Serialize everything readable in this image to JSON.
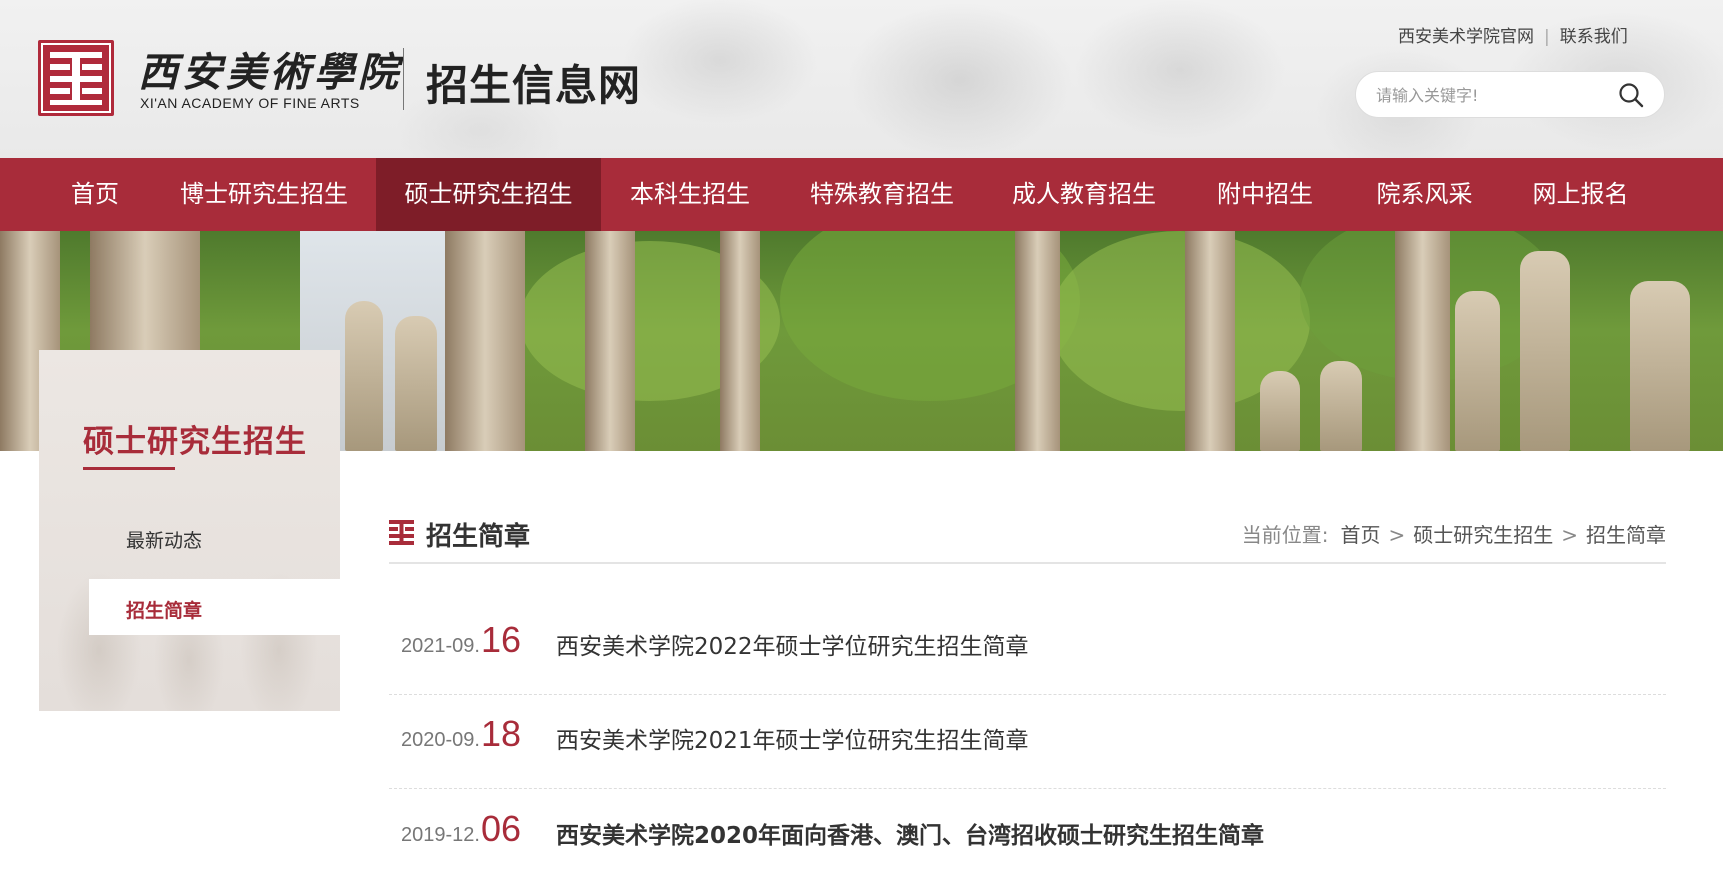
{
  "header": {
    "logo_cn": "西安美術學院",
    "logo_en": "XI'AN ACADEMY OF FINE ARTS",
    "site_title": "招生信息网",
    "top_links": [
      "西安美术学院官网",
      "联系我们"
    ],
    "search_placeholder": "请输入关键字!"
  },
  "nav": {
    "items": [
      {
        "label": "首页"
      },
      {
        "label": "博士研究生招生"
      },
      {
        "label": "硕士研究生招生",
        "active": true
      },
      {
        "label": "本科生招生"
      },
      {
        "label": "特殊教育招生"
      },
      {
        "label": "成人教育招生"
      },
      {
        "label": "附中招生"
      },
      {
        "label": "院系风采"
      },
      {
        "label": "网上报名"
      }
    ]
  },
  "sidebar": {
    "title": "硕士研究生招生",
    "items": [
      {
        "label": "最新动态"
      },
      {
        "label": "招生简章",
        "active": true
      }
    ]
  },
  "content": {
    "section_title": "招生简章",
    "breadcrumb": {
      "label": "当前位置:",
      "items": [
        "首页",
        "硕士研究生招生",
        "招生简章"
      ]
    },
    "news": [
      {
        "date_prefix": "2021-09.",
        "day": "16",
        "title": "西安美术学院2022年硕士学位研究生招生简章"
      },
      {
        "date_prefix": "2020-09.",
        "day": "18",
        "title": "西安美术学院2021年硕士学位研究生招生简章"
      },
      {
        "date_prefix": "2019-12.",
        "day": "06",
        "title": "西安美术学院2020年面向香港、澳门、台湾招收硕士研究生招生简章"
      }
    ]
  },
  "colors": {
    "brand_red": "#a82c3a",
    "nav_active": "#7e1d28"
  }
}
